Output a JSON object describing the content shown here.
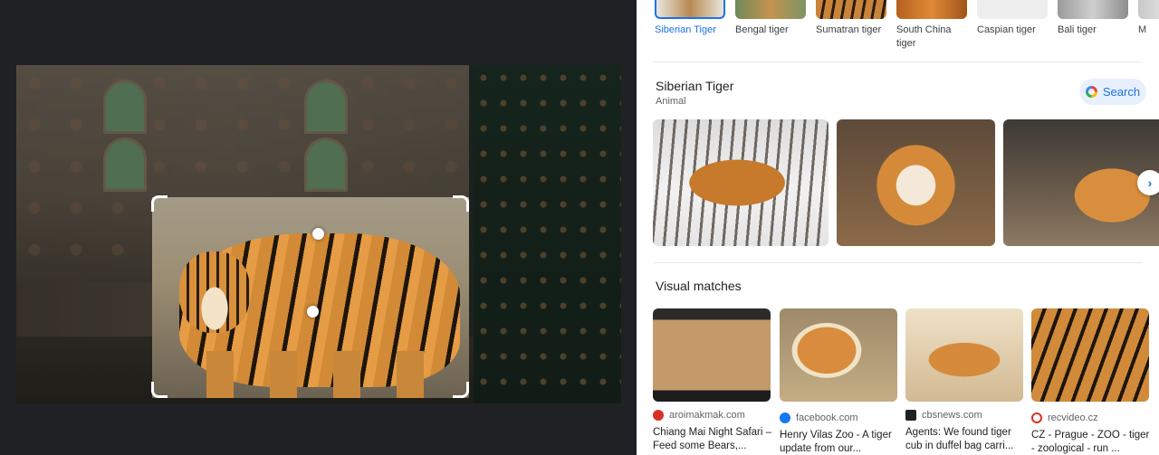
{
  "related_chips": [
    {
      "label": "Siberian Tiger",
      "selected": true
    },
    {
      "label": "Bengal tiger",
      "selected": false
    },
    {
      "label": "Sumatran tiger",
      "selected": false
    },
    {
      "label": "South China tiger",
      "selected": false
    },
    {
      "label": "Caspian tiger",
      "selected": false
    },
    {
      "label": "Bali tiger",
      "selected": false
    },
    {
      "label": "M",
      "selected": false
    }
  ],
  "entity": {
    "title": "Siberian Tiger",
    "subtitle": "Animal",
    "search_label": "Search"
  },
  "gallery_next_icon": "chevron-right-icon",
  "visual_matches": {
    "heading": "Visual matches",
    "items": [
      {
        "domain": "aroimakmak.com",
        "title": "Chiang Mai Night Safari – Feed some Bears,...",
        "favicon_color": "#d93025"
      },
      {
        "domain": "facebook.com",
        "title": "Henry Vilas Zoo - A tiger update from our...",
        "favicon_color": "#1877f2"
      },
      {
        "domain": "cbsnews.com",
        "title": "Agents: We found tiger cub in duffel bag carri...",
        "favicon_color": "#202124"
      },
      {
        "domain": "recvideo.cz",
        "title": "CZ - Prague - ZOO - tiger - zoological - run ...",
        "favicon_color": "#d93025"
      }
    ]
  },
  "colors": {
    "accent": "#1a73e8",
    "dark_pane": "#202124"
  }
}
